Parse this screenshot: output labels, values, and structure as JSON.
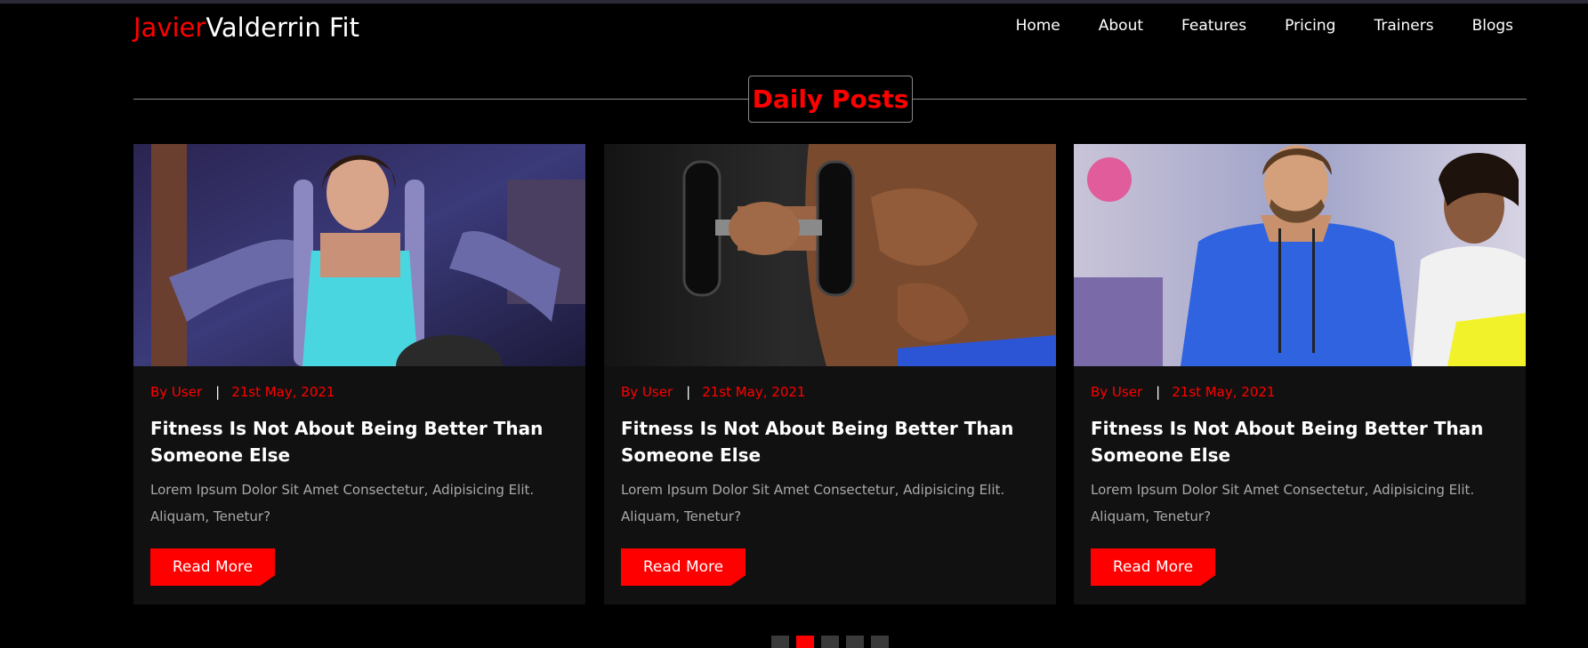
{
  "brand": {
    "first": "Javier",
    "rest": "Valderrin Fit"
  },
  "nav": [
    "Home",
    "About",
    "Features",
    "Pricing",
    "Trainers",
    "Blogs"
  ],
  "section_title": "Daily Posts",
  "posts": [
    {
      "image": "woman-chest-press-machine-photo",
      "author": "By User",
      "separator": "|",
      "date": "21st May, 2021",
      "title": "Fitness Is Not About Being Better Than Someone Else",
      "excerpt": "Lorem Ipsum Dolor Sit Amet Consectetur, Adipisicing Elit. Aliquam, Tenetur?",
      "button": "Read More"
    },
    {
      "image": "man-dumbbell-curl-photo",
      "author": "By User",
      "separator": "|",
      "date": "21st May, 2021",
      "title": "Fitness Is Not About Being Better Than Someone Else",
      "excerpt": "Lorem Ipsum Dolor Sit Amet Consectetur, Adipisicing Elit. Aliquam, Tenetur?",
      "button": "Read More"
    },
    {
      "image": "trainer-with-client-photo",
      "author": "By User",
      "separator": "|",
      "date": "21st May, 2021",
      "title": "Fitness Is Not About Being Better Than Someone Else",
      "excerpt": "Lorem Ipsum Dolor Sit Amet Consectetur, Adipisicing Elit. Aliquam, Tenetur?",
      "button": "Read More"
    }
  ],
  "pagination": {
    "count": 5,
    "active_index": 1
  },
  "colors": {
    "accent": "#ff0000",
    "background": "#000000",
    "card": "#111111",
    "muted_text": "#a9a9a9"
  }
}
